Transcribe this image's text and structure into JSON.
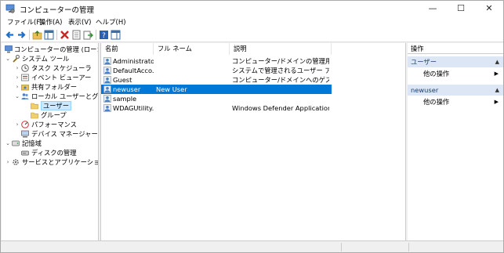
{
  "window": {
    "title": "コンピューターの管理"
  },
  "menu": [
    "ファイル(F)",
    "操作(A)",
    "表示(V)",
    "ヘルプ(H)"
  ],
  "tree": [
    {
      "label": "コンピューターの管理 (ローカル)",
      "icon": "computer-mgmt-icon",
      "expander": ""
    },
    {
      "label": "システム ツール",
      "icon": "tools-icon",
      "expander": "⌄"
    },
    {
      "label": "タスク スケジューラ",
      "icon": "clock-icon",
      "expander": "›"
    },
    {
      "label": "イベント ビューアー",
      "icon": "event-viewer-icon",
      "expander": "›"
    },
    {
      "label": "共有フォルダー",
      "icon": "shared-folder-icon",
      "expander": "›"
    },
    {
      "label": "ローカル ユーザーとグループ",
      "icon": "users-icon",
      "expander": "⌄"
    },
    {
      "label": "ユーザー",
      "icon": "folder-icon",
      "expander": ""
    },
    {
      "label": "グループ",
      "icon": "folder-icon",
      "expander": ""
    },
    {
      "label": "パフォーマンス",
      "icon": "performance-icon",
      "expander": "›"
    },
    {
      "label": "デバイス マネージャー",
      "icon": "device-manager-icon",
      "expander": ""
    },
    {
      "label": "記憶域",
      "icon": "storage-icon",
      "expander": "⌄"
    },
    {
      "label": "ディスクの管理",
      "icon": "disk-icon",
      "expander": ""
    },
    {
      "label": "サービスとアプリケーション",
      "icon": "services-icon",
      "expander": "›"
    }
  ],
  "columns": [
    "名前",
    "フル ネーム",
    "説明"
  ],
  "rows": [
    {
      "name": "Administrator",
      "fullname": "",
      "desc": "コンピューター/ドメインの管理用 (ビルト..."
    },
    {
      "name": "DefaultAcco...",
      "fullname": "",
      "desc": "システムで管理されるユーザー アカウン..."
    },
    {
      "name": "Guest",
      "fullname": "",
      "desc": "コンピューター/ドメインへのゲスト アクセ..."
    },
    {
      "name": "newuser",
      "fullname": "New User",
      "desc": ""
    },
    {
      "name": "sample",
      "fullname": "",
      "desc": ""
    },
    {
      "name": "WDAGUtility...",
      "fullname": "",
      "desc": "Windows Defender Application G..."
    }
  ],
  "actions": {
    "header": "操作",
    "sections": [
      {
        "title": "ユーザー",
        "item": "他の操作"
      },
      {
        "title": "newuser",
        "item": "他の操作"
      }
    ]
  },
  "colors": {
    "selection": "#0078d7",
    "section_bg": "#dce6f4",
    "tree_sel": "#cce8ff"
  }
}
